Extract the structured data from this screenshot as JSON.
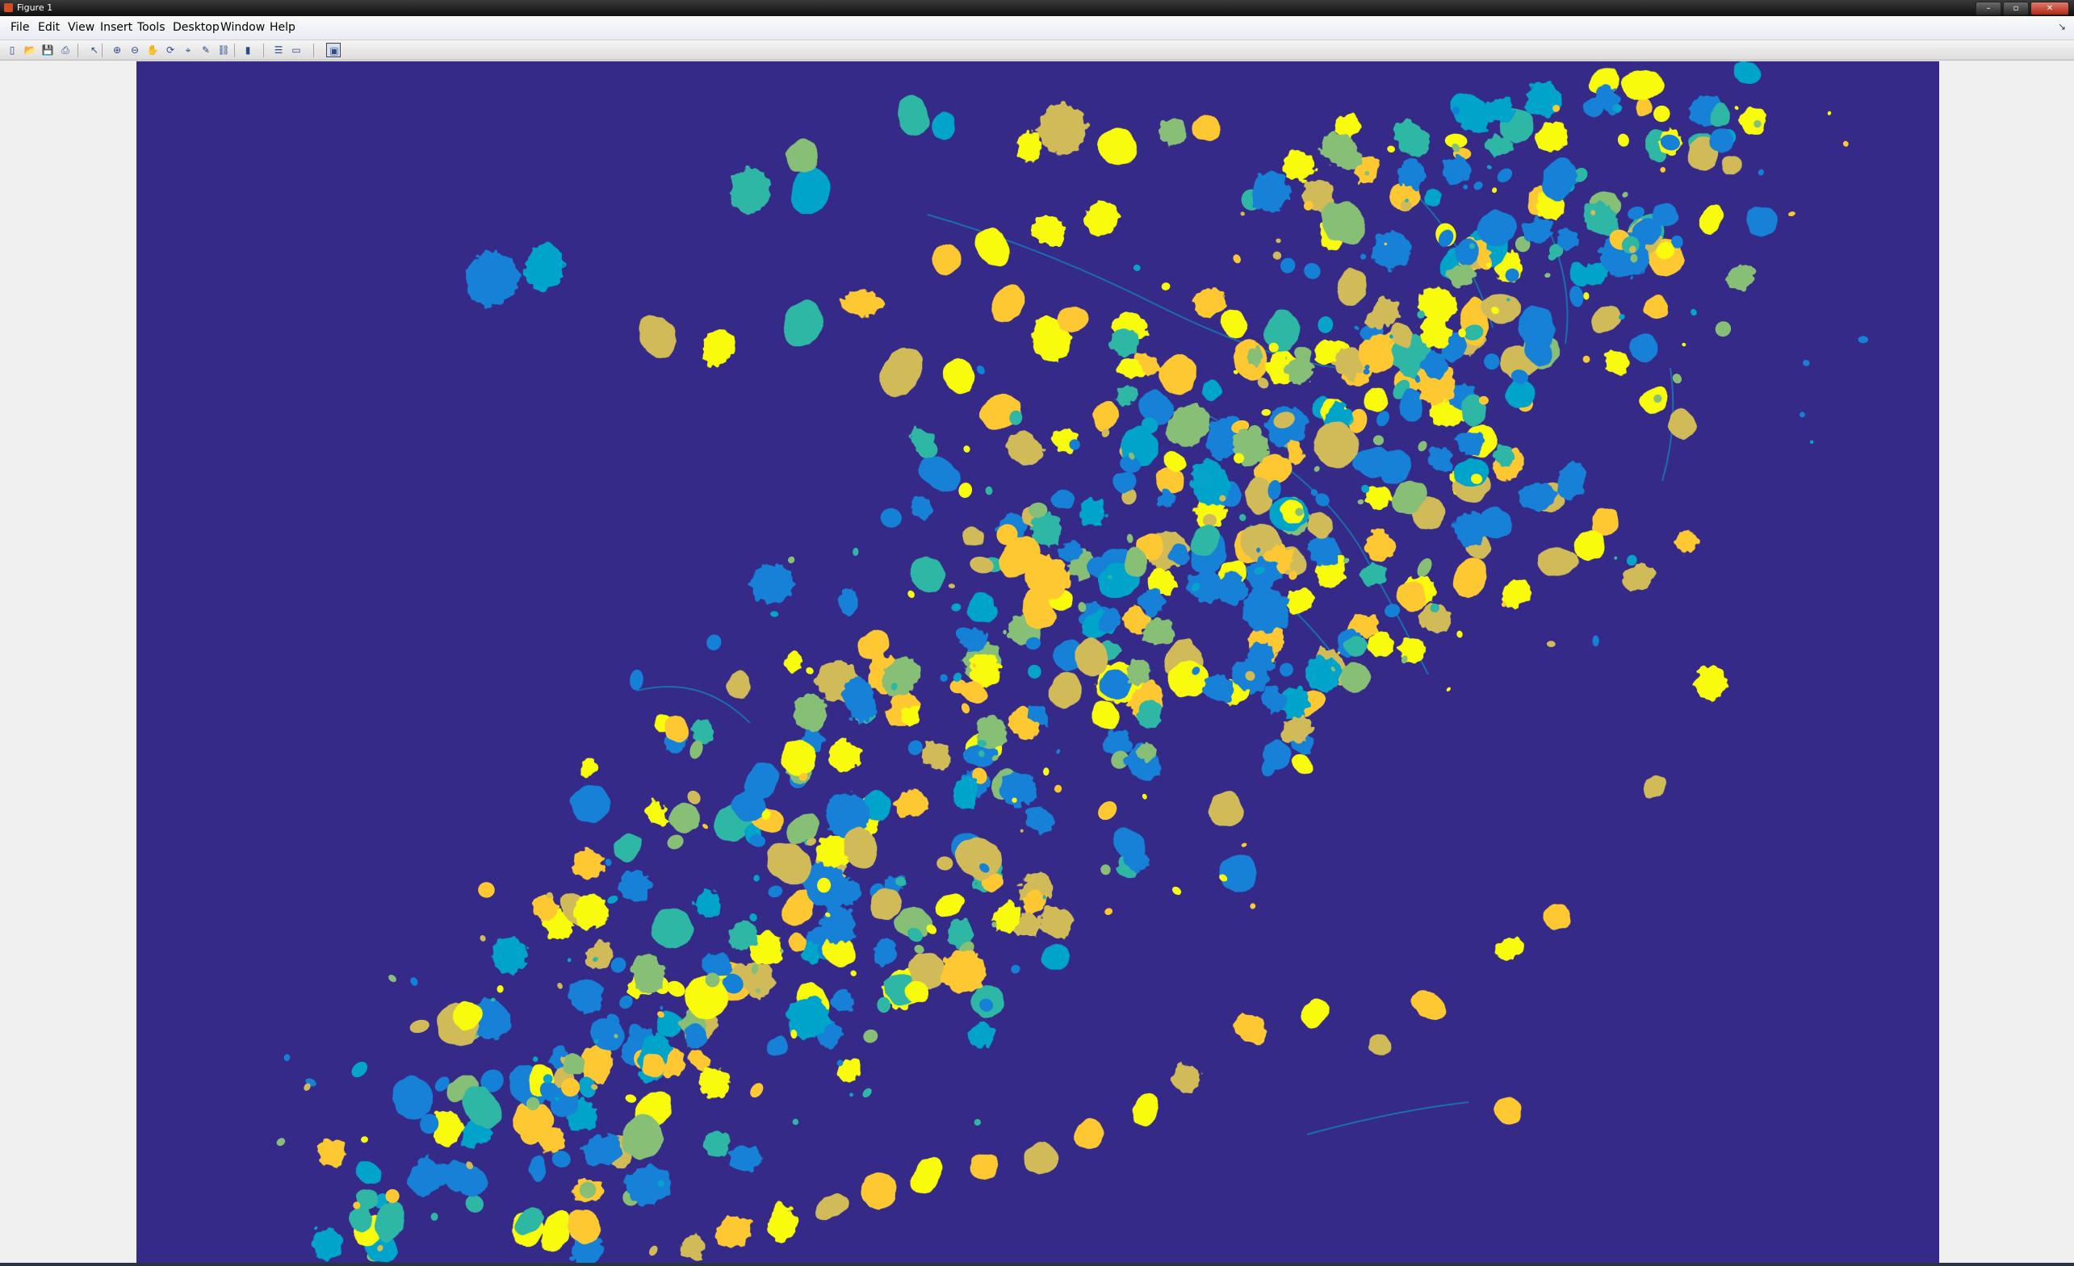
{
  "window": {
    "title": "Figure 1",
    "controls": [
      "–",
      "▫",
      "✕"
    ]
  },
  "menu": [
    "File",
    "Edit",
    "View",
    "Insert",
    "Tools",
    "Desktop",
    "Window",
    "Help"
  ],
  "toolbar": {
    "tools": [
      {
        "name": "new-figure",
        "glyph": "▯"
      },
      {
        "name": "open-file",
        "glyph": "📂"
      },
      {
        "name": "save",
        "glyph": "💾"
      },
      {
        "name": "print",
        "glyph": "⎙"
      },
      {
        "name": "edit-plot",
        "glyph": "↖"
      },
      {
        "name": "zoom-in",
        "glyph": "⊕"
      },
      {
        "name": "zoom-out",
        "glyph": "⊖"
      },
      {
        "name": "pan",
        "glyph": "✋"
      },
      {
        "name": "rotate-3d",
        "glyph": "⟳"
      },
      {
        "name": "data-cursor",
        "glyph": "⌖"
      },
      {
        "name": "brush",
        "glyph": "✎"
      },
      {
        "name": "link-plot",
        "glyph": "⛓"
      },
      {
        "name": "colorbar",
        "glyph": "▮"
      },
      {
        "name": "legend",
        "glyph": "☰"
      },
      {
        "name": "hide-plot-tools",
        "glyph": "▭"
      },
      {
        "name": "show-plot-tools",
        "glyph": "▣"
      }
    ]
  },
  "image": {
    "colormap": "parula",
    "background_color": "#352a87",
    "colormap_stops": [
      "#352a87",
      "#0f5cdd",
      "#1481d6",
      "#06a4ca",
      "#2eb7a4",
      "#87bf77",
      "#d1bb59",
      "#fec832",
      "#f9fb0e"
    ]
  }
}
